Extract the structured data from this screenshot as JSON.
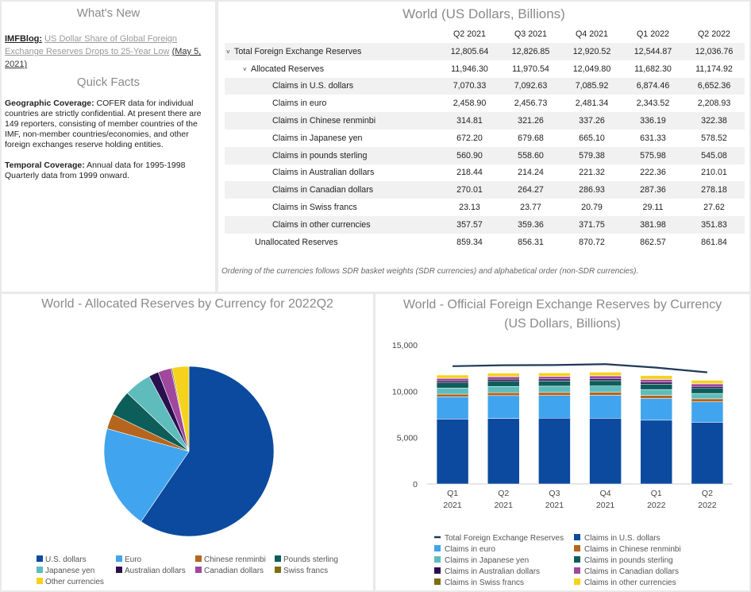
{
  "whats_new": {
    "title": "What's New",
    "blog_tag": "IMFBlog:",
    "blog_link": "US Dollar Share of Global Foreign Exchange Reserves Drops to 25-Year Low",
    "blog_date": "(May 5, 2021)",
    "quick_facts_title": "Quick Facts",
    "geo_label": "Geographic Coverage:",
    "geo_text": "COFER data for individual countries are strictly confidential. At present there are 149 reporters, consisting of member countries of the IMF, non-member countries/economies, and other foreign exchanges reserve holding entities.",
    "temp_label": "Temporal Coverage:",
    "temp_text": "Annual data for 1995-1998 Quarterly data from 1999 onward."
  },
  "table": {
    "title": "World (US Dollars, Billions)",
    "columns": [
      "Q2 2021",
      "Q3 2021",
      "Q4 2021",
      "Q1 2022",
      "Q2 2022"
    ],
    "rows": [
      {
        "label": "Total Foreign Exchange Reserves",
        "level": 0,
        "values": [
          "12,805.64",
          "12,826.85",
          "12,920.52",
          "12,544.87",
          "12,036.76"
        ]
      },
      {
        "label": "Allocated Reserves",
        "level": 1,
        "values": [
          "11,946.30",
          "11,970.54",
          "12,049.80",
          "11,682.30",
          "11,174.92"
        ]
      },
      {
        "label": "Claims in U.S. dollars",
        "level": 2,
        "values": [
          "7,070.33",
          "7,092.63",
          "7,085.92",
          "6,874.46",
          "6,652.36"
        ]
      },
      {
        "label": "Claims in euro",
        "level": 2,
        "values": [
          "2,458.90",
          "2,456.73",
          "2,481.34",
          "2,343.52",
          "2,208.93"
        ]
      },
      {
        "label": "Claims in Chinese renminbi",
        "level": 2,
        "values": [
          "314.81",
          "321.26",
          "337.26",
          "336.19",
          "322.38"
        ]
      },
      {
        "label": "Claims in Japanese yen",
        "level": 2,
        "values": [
          "672.20",
          "679.68",
          "665.10",
          "631.33",
          "578.52"
        ]
      },
      {
        "label": "Claims in pounds sterling",
        "level": 2,
        "values": [
          "560.90",
          "558.60",
          "579.38",
          "575.98",
          "545.08"
        ]
      },
      {
        "label": "Claims in Australian dollars",
        "level": 2,
        "values": [
          "218.44",
          "214.24",
          "221.32",
          "222.36",
          "210.01"
        ]
      },
      {
        "label": "Claims in Canadian dollars",
        "level": 2,
        "values": [
          "270.01",
          "264.27",
          "286.93",
          "287.36",
          "278.18"
        ]
      },
      {
        "label": "Claims in Swiss francs",
        "level": 2,
        "values": [
          "23.13",
          "23.77",
          "20.79",
          "29.11",
          "27.62"
        ]
      },
      {
        "label": "Claims in other currencies",
        "level": 2,
        "values": [
          "357.57",
          "359.36",
          "371.75",
          "381.98",
          "351.83"
        ]
      },
      {
        "label": "Unallocated Reserves",
        "level": 3,
        "values": [
          "859.34",
          "856.31",
          "870.72",
          "862.57",
          "861.84"
        ]
      }
    ],
    "note": "Ordering of the currencies follows SDR basket weights (SDR currencies) and alphabetical order (non-SDR currencies)."
  },
  "colors": {
    "usd": "#0b4a9e",
    "eur": "#41a4ee",
    "cny": "#b5651d",
    "gbp": "#0d5e5a",
    "jpy": "#5fbcbc",
    "aud": "#2a0f4f",
    "cad": "#a0479e",
    "chf": "#7a6e12",
    "oth": "#f5d21c",
    "total": "#1f3a5a"
  },
  "chart_data": [
    {
      "type": "pie",
      "title": "World - Allocated Reserves by Currency for 2022Q2",
      "slices": [
        {
          "name": "U.S. dollars",
          "value": 6652.36,
          "color_key": "usd"
        },
        {
          "name": "Euro",
          "value": 2208.93,
          "color_key": "eur"
        },
        {
          "name": "Chinese renminbi",
          "value": 322.38,
          "color_key": "cny"
        },
        {
          "name": "Pounds sterling",
          "value": 545.08,
          "color_key": "gbp"
        },
        {
          "name": "Japanese yen",
          "value": 578.52,
          "color_key": "jpy"
        },
        {
          "name": "Australian dollars",
          "value": 210.01,
          "color_key": "aud"
        },
        {
          "name": "Canadian dollars",
          "value": 278.18,
          "color_key": "cad"
        },
        {
          "name": "Swiss francs",
          "value": 27.62,
          "color_key": "chf"
        },
        {
          "name": "Other currencies",
          "value": 351.83,
          "color_key": "oth"
        }
      ],
      "legend_position": "bottom"
    },
    {
      "type": "bar",
      "stacked": true,
      "title": "World - Official Foreign Exchange Reserves by Currency",
      "subtitle": "(US Dollars, Billions)",
      "categories": [
        [
          "Q1",
          "2021"
        ],
        [
          "Q2",
          "2021"
        ],
        [
          "Q3",
          "2021"
        ],
        [
          "Q4",
          "2021"
        ],
        [
          "Q1",
          "2022"
        ],
        [
          "Q2",
          "2022"
        ]
      ],
      "ylim": [
        0,
        15000
      ],
      "yticks": [
        "0",
        "5,000",
        "10,000",
        "15,000"
      ],
      "ytick_values": [
        0,
        5000,
        10000,
        15000
      ],
      "grid": false,
      "legend_position": "bottom",
      "line_series": {
        "name": "Total Foreign Exchange Reserves",
        "color_key": "total",
        "values": [
          12700,
          12805.64,
          12826.85,
          12920.52,
          12544.87,
          12036.76
        ]
      },
      "series": [
        {
          "name": "Claims in U.S. dollars",
          "color_key": "usd",
          "values": [
            7000,
            7070.33,
            7092.63,
            7085.92,
            6874.46,
            6652.36
          ]
        },
        {
          "name": "Claims in euro",
          "color_key": "eur",
          "values": [
            2400,
            2458.9,
            2456.73,
            2481.34,
            2343.52,
            2208.93
          ]
        },
        {
          "name": "Claims in Chinese renminbi",
          "color_key": "cny",
          "values": [
            287,
            314.81,
            321.26,
            337.26,
            336.19,
            322.38
          ]
        },
        {
          "name": "Claims in Japanese yen",
          "color_key": "jpy",
          "values": [
            660,
            672.2,
            679.68,
            665.1,
            631.33,
            578.52
          ]
        },
        {
          "name": "Claims in pounds sterling",
          "color_key": "gbp",
          "values": [
            560,
            560.9,
            558.6,
            579.38,
            575.98,
            545.08
          ]
        },
        {
          "name": "Claims in Australian dollars",
          "color_key": "aud",
          "values": [
            210,
            218.44,
            214.24,
            221.32,
            222.36,
            210.01
          ]
        },
        {
          "name": "Claims in Canadian dollars",
          "color_key": "cad",
          "values": [
            265,
            270.01,
            264.27,
            286.93,
            287.36,
            278.18
          ]
        },
        {
          "name": "Claims in Swiss francs",
          "color_key": "chf",
          "values": [
            22,
            23.13,
            23.77,
            20.79,
            29.11,
            27.62
          ]
        },
        {
          "name": "Claims in other currencies",
          "color_key": "oth",
          "values": [
            340,
            357.57,
            359.36,
            371.75,
            381.98,
            351.83
          ]
        }
      ]
    }
  ]
}
